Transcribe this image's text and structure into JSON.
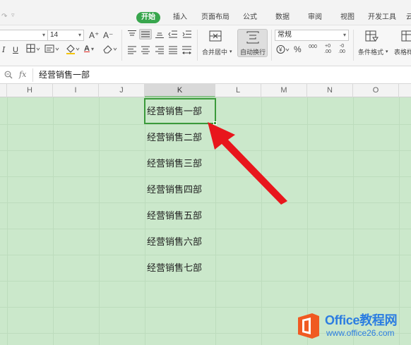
{
  "tabs": [
    {
      "label": "开始",
      "active": true
    },
    {
      "label": "插入",
      "active": false
    },
    {
      "label": "页面布局",
      "active": false
    },
    {
      "label": "公式",
      "active": false
    },
    {
      "label": "数据",
      "active": false
    },
    {
      "label": "审阅",
      "active": false
    },
    {
      "label": "视图",
      "active": false
    },
    {
      "label": "开发工具",
      "active": false
    },
    {
      "label": "云",
      "active": false
    }
  ],
  "ribbon": {
    "font_size": "14",
    "number_format": "常规",
    "merge_label": "合并居中",
    "wrap_label": "自动换行",
    "cond_format_label": "条件格式",
    "table_style_label": "表格样",
    "grow_font": "A⁺",
    "shrink_font": "A⁻",
    "italic": "I",
    "underline": "U",
    "font_color_glyph": "A",
    "percent": "%",
    "thousands": "000",
    "inc_decimal": "+0 .00",
    "dec_decimal": "-0 .00"
  },
  "formula_bar": {
    "fx": "fx",
    "value": "经营销售一部"
  },
  "columns": [
    "H",
    "I",
    "J",
    "K",
    "L",
    "M",
    "N",
    "O"
  ],
  "active_column": "K",
  "cells": [
    "经营销售一部",
    "经营销售二部",
    "经营销售三部",
    "经营销售四部",
    "经营销售五部",
    "经营销售六部",
    "经营销售七部"
  ],
  "selected_cell_index": 0,
  "watermark": {
    "title": "Office教程网",
    "url": "www.office26.com"
  },
  "colors": {
    "tab_active": "#38a64d",
    "grid_fill": "#cbe8cb",
    "selection": "#3a9a3a",
    "arrow": "#e8161c",
    "watermark_blue": "#2b7de1",
    "logo_orange": "#f05a22"
  }
}
